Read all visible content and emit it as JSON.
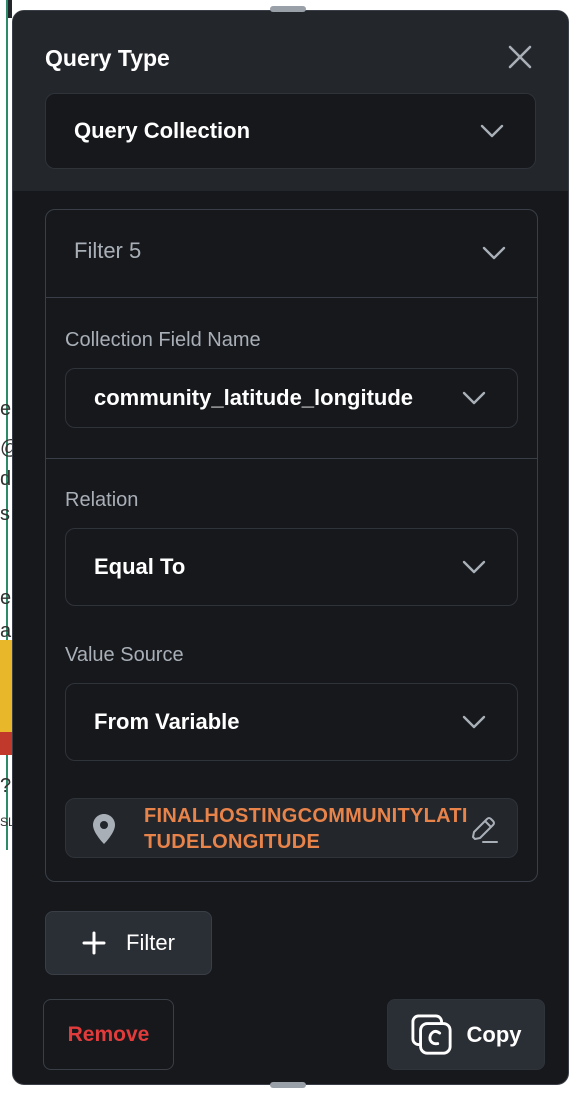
{
  "background_fragments": {
    "chars": [
      "e",
      "@",
      "d",
      "s",
      "e",
      "a",
      "?",
      "SL"
    ]
  },
  "panel": {
    "title": "Query Type",
    "close_icon": "close-icon",
    "query_type_value": "Query Collection"
  },
  "filter": {
    "title": "Filter 5",
    "collection_field_label": "Collection Field Name",
    "collection_field_value": "community_latitude_longitude",
    "relation_label": "Relation",
    "relation_value": "Equal To",
    "value_source_label": "Value Source",
    "value_source_value": "From Variable",
    "variable_name": "FINALHOSTINGCOMMUNITYLATITUDELONGITUDE",
    "variable_icon": "location-pin-icon",
    "edit_icon": "edit-pencil-icon"
  },
  "actions": {
    "add_filter_label": "Filter",
    "remove_label": "Remove",
    "copy_label": "Copy"
  },
  "colors": {
    "panel_bg": "#16181c",
    "header_bg": "#23262b",
    "variable_text": "#e8834a",
    "remove_text": "#e23b3b"
  }
}
